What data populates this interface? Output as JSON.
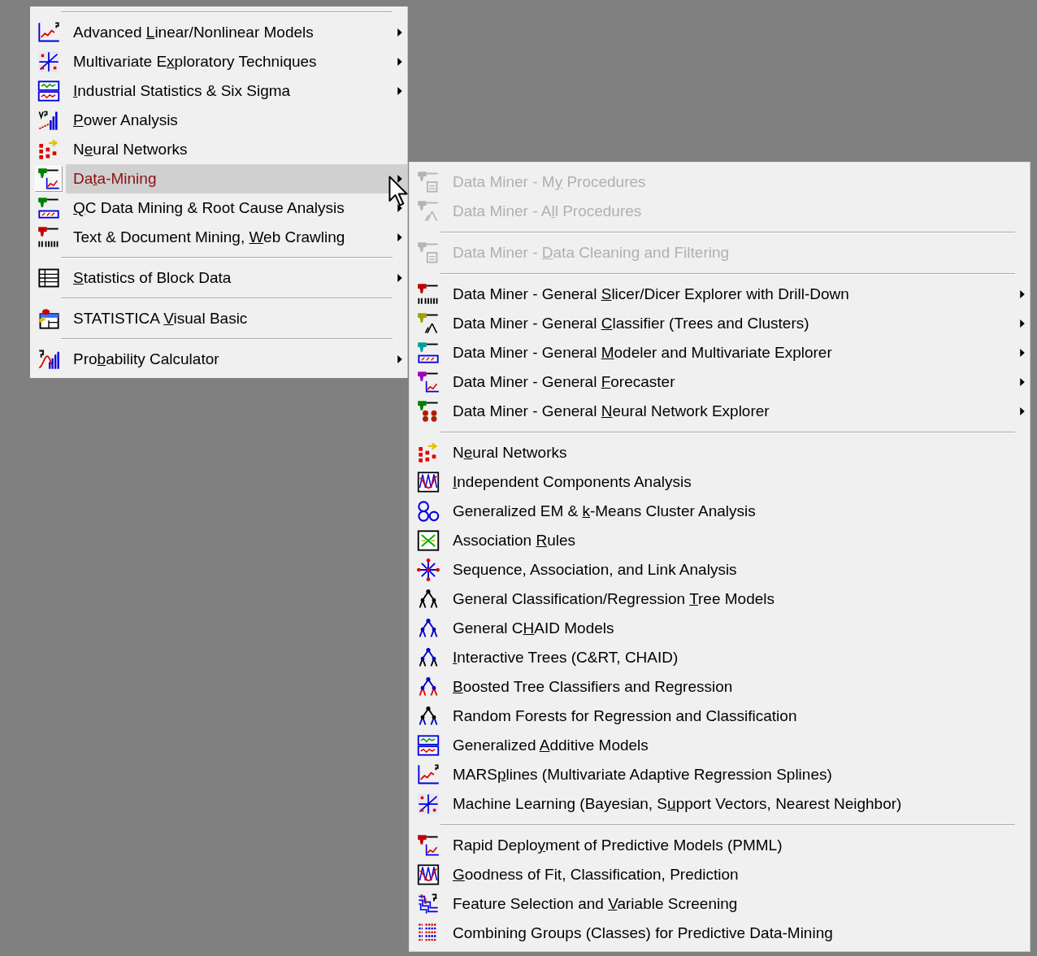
{
  "menus": [
    {
      "items": [
        {
          "kind": "separator"
        },
        {
          "kind": "item",
          "label": {
            "before": "Advanced ",
            "mnemonic": "L",
            "after": "inear/Nonlinear Models"
          },
          "has_submenu": true,
          "selected": false,
          "disabled": false
        },
        {
          "kind": "item",
          "label": {
            "before": "Multivariate E",
            "mnemonic": "x",
            "after": "ploratory Techniques"
          },
          "has_submenu": true,
          "selected": false,
          "disabled": false
        },
        {
          "kind": "item",
          "label": {
            "mnemonic": "I",
            "after": "ndustrial Statistics & Six Sigma"
          },
          "has_submenu": true,
          "selected": false,
          "disabled": false
        },
        {
          "kind": "item",
          "label": {
            "mnemonic": "P",
            "after": "ower Analysis"
          },
          "has_submenu": false,
          "selected": false,
          "disabled": false
        },
        {
          "kind": "item",
          "label": {
            "before": "N",
            "mnemonic": "e",
            "after": "ural Networks"
          },
          "has_submenu": false,
          "selected": false,
          "disabled": false
        },
        {
          "kind": "item",
          "label": {
            "before": "Da",
            "mnemonic": "t",
            "after": "a-Mining"
          },
          "has_submenu": true,
          "selected": true,
          "disabled": false
        },
        {
          "kind": "item",
          "label": {
            "mnemonic": "Q",
            "after": "C Data Mining & Root Cause Analysis"
          },
          "has_submenu": true,
          "selected": false,
          "disabled": false
        },
        {
          "kind": "item",
          "label": {
            "before": "Text & Document Mining, ",
            "mnemonic": "W",
            "after": "eb Crawling"
          },
          "has_submenu": true,
          "selected": false,
          "disabled": false
        },
        {
          "kind": "separator"
        },
        {
          "kind": "item",
          "label": {
            "mnemonic": "S",
            "after": "tatistics of Block Data"
          },
          "has_submenu": true,
          "selected": false,
          "disabled": false
        },
        {
          "kind": "separator"
        },
        {
          "kind": "item",
          "label": {
            "before": "STATISTICA ",
            "mnemonic": "V",
            "after": "isual Basic"
          },
          "has_submenu": false,
          "selected": false,
          "disabled": false
        },
        {
          "kind": "separator"
        },
        {
          "kind": "item",
          "label": {
            "before": "Pro",
            "mnemonic": "b",
            "after": "ability Calculator"
          },
          "has_submenu": true,
          "selected": false,
          "disabled": false
        }
      ]
    },
    {
      "items": [
        {
          "kind": "item",
          "label": {
            "before": "Data Miner - M",
            "mnemonic": "y",
            "after": " Procedures"
          },
          "has_submenu": false,
          "selected": false,
          "disabled": true
        },
        {
          "kind": "item",
          "label": {
            "before": "Data Miner - A",
            "mnemonic": "l",
            "after": "l Procedures"
          },
          "has_submenu": false,
          "selected": false,
          "disabled": true
        },
        {
          "kind": "separator"
        },
        {
          "kind": "item",
          "label": {
            "before": "Data Miner - ",
            "mnemonic": "D",
            "after": "ata Cleaning and Filtering"
          },
          "has_submenu": false,
          "selected": false,
          "disabled": true
        },
        {
          "kind": "separator"
        },
        {
          "kind": "item",
          "label": {
            "before": "Data Miner - General ",
            "mnemonic": "S",
            "after": "licer/Dicer Explorer with Drill-Down"
          },
          "has_submenu": true,
          "selected": false,
          "disabled": false
        },
        {
          "kind": "item",
          "label": {
            "before": "Data Miner - General ",
            "mnemonic": "C",
            "after": "lassifier (Trees and Clusters)"
          },
          "has_submenu": true,
          "selected": false,
          "disabled": false
        },
        {
          "kind": "item",
          "label": {
            "before": "Data Miner - General ",
            "mnemonic": "M",
            "after": "odeler and Multivariate Explorer"
          },
          "has_submenu": true,
          "selected": false,
          "disabled": false
        },
        {
          "kind": "item",
          "label": {
            "before": "Data Miner - General ",
            "mnemonic": "F",
            "after": "orecaster"
          },
          "has_submenu": true,
          "selected": false,
          "disabled": false
        },
        {
          "kind": "item",
          "label": {
            "before": "Data Miner - General ",
            "mnemonic": "N",
            "after": "eural Network Explorer"
          },
          "has_submenu": true,
          "selected": false,
          "disabled": false
        },
        {
          "kind": "separator"
        },
        {
          "kind": "item",
          "label": {
            "before": "N",
            "mnemonic": "e",
            "after": "ural Networks"
          },
          "has_submenu": false,
          "selected": false,
          "disabled": false
        },
        {
          "kind": "item",
          "label": {
            "mnemonic": "I",
            "after": "ndependent Components Analysis"
          },
          "has_submenu": false,
          "selected": false,
          "disabled": false
        },
        {
          "kind": "item",
          "label": {
            "before": "Generalized EM & ",
            "mnemonic": "k",
            "after": "-Means Cluster Analysis"
          },
          "has_submenu": false,
          "selected": false,
          "disabled": false
        },
        {
          "kind": "item",
          "label": {
            "before": "Association ",
            "mnemonic": "R",
            "after": "ules"
          },
          "has_submenu": false,
          "selected": false,
          "disabled": false
        },
        {
          "kind": "item",
          "label": {
            "before": "Sequence, Association, and Link Analysis"
          },
          "has_submenu": false,
          "selected": false,
          "disabled": false
        },
        {
          "kind": "item",
          "label": {
            "before": "General Classification/Regression ",
            "mnemonic": "T",
            "after": "ree Models"
          },
          "has_submenu": false,
          "selected": false,
          "disabled": false
        },
        {
          "kind": "item",
          "label": {
            "before": "General C",
            "mnemonic": "H",
            "after": "AID Models"
          },
          "has_submenu": false,
          "selected": false,
          "disabled": false
        },
        {
          "kind": "item",
          "label": {
            "mnemonic": "I",
            "after": "nteractive Trees (C&RT, CHAID)"
          },
          "has_submenu": false,
          "selected": false,
          "disabled": false
        },
        {
          "kind": "item",
          "label": {
            "mnemonic": "B",
            "after": "oosted Tree Classifiers and Regression"
          },
          "has_submenu": false,
          "selected": false,
          "disabled": false
        },
        {
          "kind": "item",
          "label": {
            "before": "Random Forests for Regression and Classification"
          },
          "has_submenu": false,
          "selected": false,
          "disabled": false
        },
        {
          "kind": "item",
          "label": {
            "before": "Generalized ",
            "mnemonic": "A",
            "after": "dditive Models"
          },
          "has_submenu": false,
          "selected": false,
          "disabled": false
        },
        {
          "kind": "item",
          "label": {
            "before": "MARS",
            "mnemonic": "p",
            "after": "lines (Multivariate Adaptive Regression Splines)"
          },
          "has_submenu": false,
          "selected": false,
          "disabled": false
        },
        {
          "kind": "item",
          "label": {
            "before": "Machine Learning (Bayesian, S",
            "mnemonic": "u",
            "after": "pport Vectors, Nearest Neighbor)"
          },
          "has_submenu": false,
          "selected": false,
          "disabled": false
        },
        {
          "kind": "separator"
        },
        {
          "kind": "item",
          "label": {
            "before": "Rapid Deplo",
            "mnemonic": "y",
            "after": "ment of Predictive Models (PMML)"
          },
          "has_submenu": false,
          "selected": false,
          "disabled": false
        },
        {
          "kind": "item",
          "label": {
            "mnemonic": "G",
            "after": "oodness of Fit, Classification, Prediction"
          },
          "has_submenu": false,
          "selected": false,
          "disabled": false
        },
        {
          "kind": "item",
          "label": {
            "before": "Feature Selection and ",
            "mnemonic": "V",
            "after": "ariable Screening"
          },
          "has_submenu": false,
          "selected": false,
          "disabled": false
        },
        {
          "kind": "item",
          "label": {
            "before": "Combining Groups (Classes) for Predictive Data-Mining"
          },
          "has_submenu": false,
          "selected": false,
          "disabled": false
        }
      ]
    }
  ]
}
